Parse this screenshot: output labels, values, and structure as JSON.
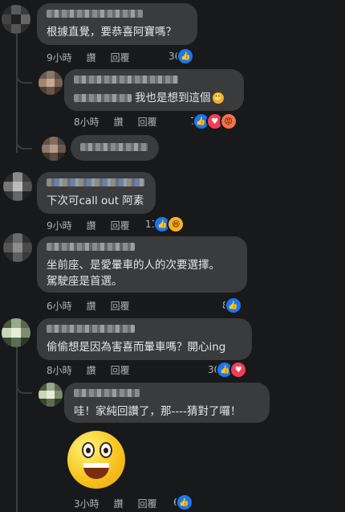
{
  "comments": [
    {
      "text": "根據直覺，要恭喜阿寶嗎？",
      "time": "9小時",
      "like": "讚",
      "reply": "回覆",
      "reactions": [
        "like"
      ],
      "count": "36"
    },
    {
      "text": "我也是想到這個",
      "time": "8小時",
      "like": "讚",
      "reply": "回覆",
      "reactions": [
        "like",
        "love",
        "angry"
      ],
      "count": "7"
    },
    {
      "text": "下次可call out 阿素",
      "time": "9小時",
      "like": "讚",
      "reply": "回覆",
      "reactions": [
        "like",
        "haha"
      ],
      "count": "13"
    },
    {
      "text_line1": "坐前座、是愛暈車的人的次要選擇。",
      "text_line2": "駕駛座是首選。",
      "time": "6小時",
      "like": "讚",
      "reply": "回覆",
      "reactions": [
        "like"
      ],
      "count": "8"
    },
    {
      "text": "偷偷想是因為害喜而暈車嗎？開心ing",
      "time": "8小時",
      "like": "讚",
      "reply": "回覆",
      "reactions": [
        "like",
        "love"
      ],
      "count": "30"
    },
    {
      "text": "哇！家純回讚了，那----猜對了囉！",
      "time": "3小時",
      "like": "讚",
      "reply": "回覆",
      "reactions": [
        "like"
      ],
      "count": "6"
    }
  ],
  "reaction_icons": {
    "like": "thumbs-up-icon",
    "love": "heart-icon",
    "angry": "angry-face-icon",
    "haha": "laughing-face-icon",
    "wow": "grinning-face-emoji"
  },
  "colors": {
    "background": "#18191a",
    "bubble": "#3a3b3c",
    "text": "#e4e6eb",
    "meta": "#b0b3b8",
    "like": "#1877f2",
    "love": "#f33e58"
  }
}
